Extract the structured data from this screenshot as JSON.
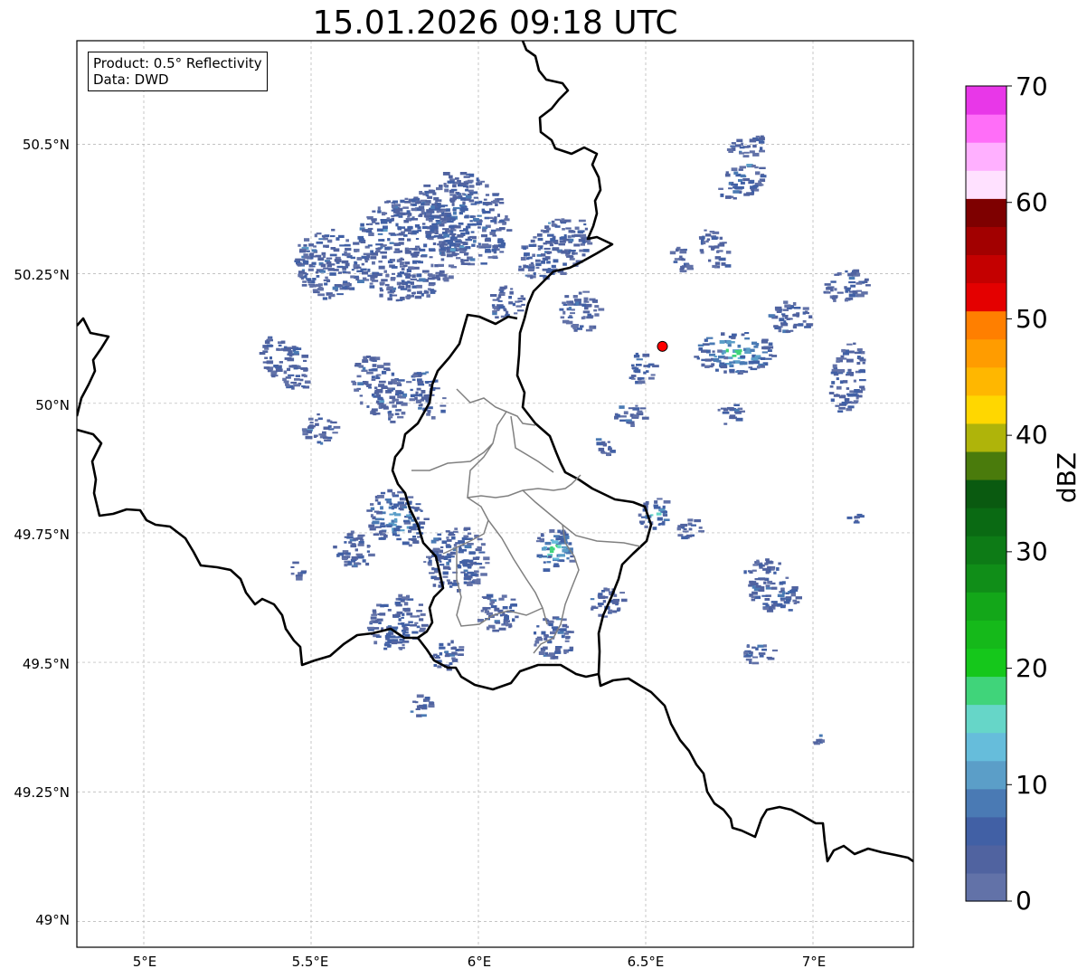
{
  "title": "15.01.2026 09:18 UTC",
  "info": {
    "product": "Product: 0.5° Reflectivity",
    "source": "Data: DWD"
  },
  "axes": {
    "x_ticks": [
      "5°E",
      "5.5°E",
      "6°E",
      "6.5°E",
      "7°E"
    ],
    "x_values": [
      5.0,
      5.5,
      6.0,
      6.5,
      7.0
    ],
    "y_ticks": [
      "50.5°N",
      "50.25°N",
      "50°N",
      "49.75°N",
      "49.5°N",
      "49.25°N",
      "49°N"
    ],
    "y_values": [
      50.5,
      50.25,
      50.0,
      49.75,
      49.5,
      49.25,
      49.0
    ],
    "lon_range": [
      4.8,
      7.3
    ],
    "lat_range": [
      48.95,
      50.7
    ],
    "grid": true
  },
  "radar_site": {
    "lon": 6.55,
    "lat": 50.11,
    "color": "#ff0000"
  },
  "colorbar": {
    "label": "dBZ",
    "ticks": [
      "0",
      "10",
      "20",
      "30",
      "40",
      "50",
      "60",
      "70"
    ],
    "tick_values": [
      0,
      10,
      20,
      30,
      40,
      50,
      60,
      70
    ],
    "range": [
      0,
      70
    ],
    "step": 2.5,
    "colors": [
      "#6272a8",
      "#5063a0",
      "#4160a5",
      "#4a7ab4",
      "#5b9ec8",
      "#66bddb",
      "#66d6c8",
      "#40d47a",
      "#15c71b",
      "#15b91a",
      "#13a719",
      "#108e18",
      "#0d7b16",
      "#0a6a13",
      "#0a5a10",
      "#4a7b0c",
      "#afb40a",
      "#ffd700",
      "#ffb700",
      "#ff9c00",
      "#ff7f00",
      "#e40000",
      "#c40000",
      "#a20000",
      "#7e0000",
      "#ffe1ff",
      "#ffb0ff",
      "#ff6ef8",
      "#e837e8"
    ]
  },
  "precip_cells": [
    {
      "lon": 5.78,
      "lat": 50.3,
      "rx": 0.16,
      "ry": 0.1,
      "rot": -40,
      "dbz": 3
    },
    {
      "lon": 5.95,
      "lat": 50.36,
      "rx": 0.12,
      "ry": 0.1,
      "rot": -40,
      "dbz": 5
    },
    {
      "lon": 5.55,
      "lat": 50.27,
      "rx": 0.1,
      "ry": 0.07,
      "rot": -35,
      "dbz": 3
    },
    {
      "lon": 5.42,
      "lat": 50.08,
      "rx": 0.06,
      "ry": 0.06,
      "rot": -40,
      "dbz": 3
    },
    {
      "lon": 5.7,
      "lat": 50.03,
      "rx": 0.07,
      "ry": 0.07,
      "rot": -30,
      "dbz": 4
    },
    {
      "lon": 5.84,
      "lat": 50.02,
      "rx": 0.05,
      "ry": 0.05,
      "rot": -30,
      "dbz": 4
    },
    {
      "lon": 5.52,
      "lat": 49.95,
      "rx": 0.05,
      "ry": 0.03,
      "rot": -40,
      "dbz": 3
    },
    {
      "lon": 6.22,
      "lat": 50.3,
      "rx": 0.12,
      "ry": 0.05,
      "rot": -35,
      "dbz": 4
    },
    {
      "lon": 6.3,
      "lat": 50.18,
      "rx": 0.06,
      "ry": 0.04,
      "rot": -35,
      "dbz": 3
    },
    {
      "lon": 6.08,
      "lat": 50.2,
      "rx": 0.06,
      "ry": 0.03,
      "rot": -40,
      "dbz": 3
    },
    {
      "lon": 5.75,
      "lat": 49.78,
      "rx": 0.08,
      "ry": 0.06,
      "rot": -50,
      "dbz": 12
    },
    {
      "lon": 5.93,
      "lat": 49.7,
      "rx": 0.1,
      "ry": 0.06,
      "rot": -50,
      "dbz": 5
    },
    {
      "lon": 5.62,
      "lat": 49.72,
      "rx": 0.05,
      "ry": 0.04,
      "rot": -50,
      "dbz": 4
    },
    {
      "lon": 5.75,
      "lat": 49.58,
      "rx": 0.09,
      "ry": 0.05,
      "rot": -45,
      "dbz": 5
    },
    {
      "lon": 5.9,
      "lat": 49.52,
      "rx": 0.05,
      "ry": 0.03,
      "rot": -40,
      "dbz": 4
    },
    {
      "lon": 6.05,
      "lat": 49.6,
      "rx": 0.06,
      "ry": 0.04,
      "rot": -40,
      "dbz": 4
    },
    {
      "lon": 6.22,
      "lat": 49.72,
      "rx": 0.07,
      "ry": 0.04,
      "rot": -30,
      "dbz": 19
    },
    {
      "lon": 6.22,
      "lat": 49.55,
      "rx": 0.06,
      "ry": 0.04,
      "rot": -20,
      "dbz": 4
    },
    {
      "lon": 6.38,
      "lat": 49.62,
      "rx": 0.05,
      "ry": 0.03,
      "rot": -20,
      "dbz": 3
    },
    {
      "lon": 6.52,
      "lat": 49.79,
      "rx": 0.05,
      "ry": 0.03,
      "rot": -30,
      "dbz": 15
    },
    {
      "lon": 6.63,
      "lat": 49.76,
      "rx": 0.04,
      "ry": 0.02,
      "rot": -20,
      "dbz": 3
    },
    {
      "lon": 6.45,
      "lat": 49.98,
      "rx": 0.05,
      "ry": 0.02,
      "rot": 0,
      "dbz": 3
    },
    {
      "lon": 6.75,
      "lat": 49.98,
      "rx": 0.04,
      "ry": 0.02,
      "rot": 0,
      "dbz": 3
    },
    {
      "lon": 6.37,
      "lat": 49.92,
      "rx": 0.03,
      "ry": 0.02,
      "rot": 0,
      "dbz": 3
    },
    {
      "lon": 6.48,
      "lat": 50.07,
      "rx": 0.04,
      "ry": 0.03,
      "rot": 0,
      "dbz": 7
    },
    {
      "lon": 6.76,
      "lat": 50.1,
      "rx": 0.12,
      "ry": 0.04,
      "rot": 0,
      "dbz": 19
    },
    {
      "lon": 6.93,
      "lat": 50.17,
      "rx": 0.07,
      "ry": 0.03,
      "rot": 0,
      "dbz": 3
    },
    {
      "lon": 7.09,
      "lat": 50.23,
      "rx": 0.07,
      "ry": 0.03,
      "rot": -10,
      "dbz": 3
    },
    {
      "lon": 7.1,
      "lat": 50.05,
      "rx": 0.05,
      "ry": 0.07,
      "rot": 10,
      "dbz": 4
    },
    {
      "lon": 6.78,
      "lat": 50.43,
      "rx": 0.08,
      "ry": 0.03,
      "rot": -20,
      "dbz": 7
    },
    {
      "lon": 6.8,
      "lat": 50.5,
      "rx": 0.06,
      "ry": 0.02,
      "rot": -10,
      "dbz": 3
    },
    {
      "lon": 6.7,
      "lat": 50.3,
      "rx": 0.04,
      "ry": 0.04,
      "rot": -30,
      "dbz": 3
    },
    {
      "lon": 6.6,
      "lat": 50.28,
      "rx": 0.03,
      "ry": 0.03,
      "rot": -30,
      "dbz": 3
    },
    {
      "lon": 6.87,
      "lat": 49.65,
      "rx": 0.07,
      "ry": 0.06,
      "rot": -40,
      "dbz": 4
    },
    {
      "lon": 6.83,
      "lat": 49.52,
      "rx": 0.05,
      "ry": 0.02,
      "rot": 0,
      "dbz": 3
    },
    {
      "lon": 7.12,
      "lat": 49.78,
      "rx": 0.03,
      "ry": 0.01,
      "rot": -30,
      "dbz": 3
    },
    {
      "lon": 7.0,
      "lat": 49.35,
      "rx": 0.03,
      "ry": 0.01,
      "rot": -20,
      "dbz": 3
    },
    {
      "lon": 5.82,
      "lat": 49.42,
      "rx": 0.04,
      "ry": 0.02,
      "rot": -50,
      "dbz": 3
    },
    {
      "lon": 5.45,
      "lat": 49.68,
      "rx": 0.02,
      "ry": 0.02,
      "rot": -50,
      "dbz": 3
    }
  ]
}
